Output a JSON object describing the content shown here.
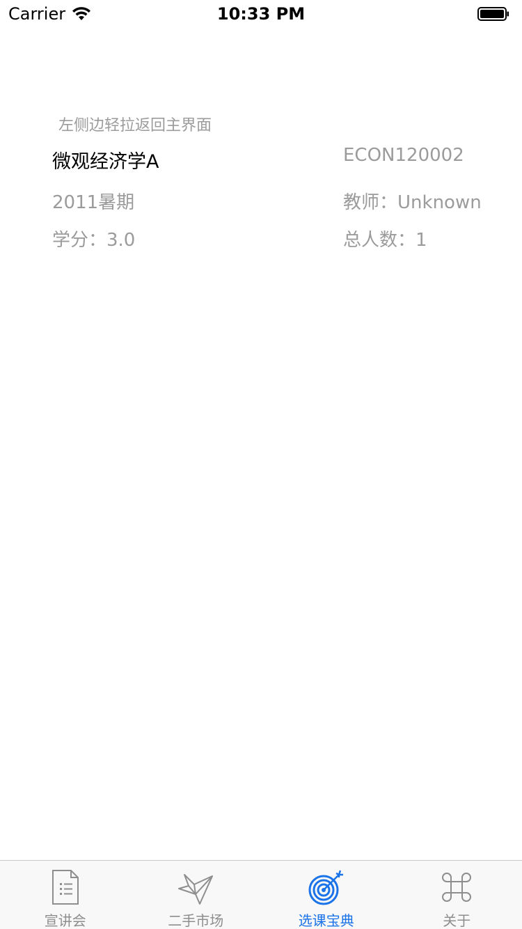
{
  "status_bar": {
    "carrier": "Carrier",
    "time": "10:33 PM"
  },
  "content": {
    "hint": "左侧边轻拉返回主界面",
    "course_name": "微观经济学A",
    "course_code": "ECON120002",
    "semester": "2011暑期",
    "teacher": "教师：Unknown",
    "credit": "学分：3.0",
    "total": "总人数：1"
  },
  "tab_bar": {
    "active_color": "#1a73e8",
    "inactive_color": "#8e8e8e",
    "tabs": [
      {
        "label": "宣讲会",
        "icon": "document-icon"
      },
      {
        "label": "二手市场",
        "icon": "origami-bird-icon"
      },
      {
        "label": "选课宝典",
        "icon": "target-icon",
        "active": true
      },
      {
        "label": "关于",
        "icon": "command-icon"
      }
    ]
  }
}
